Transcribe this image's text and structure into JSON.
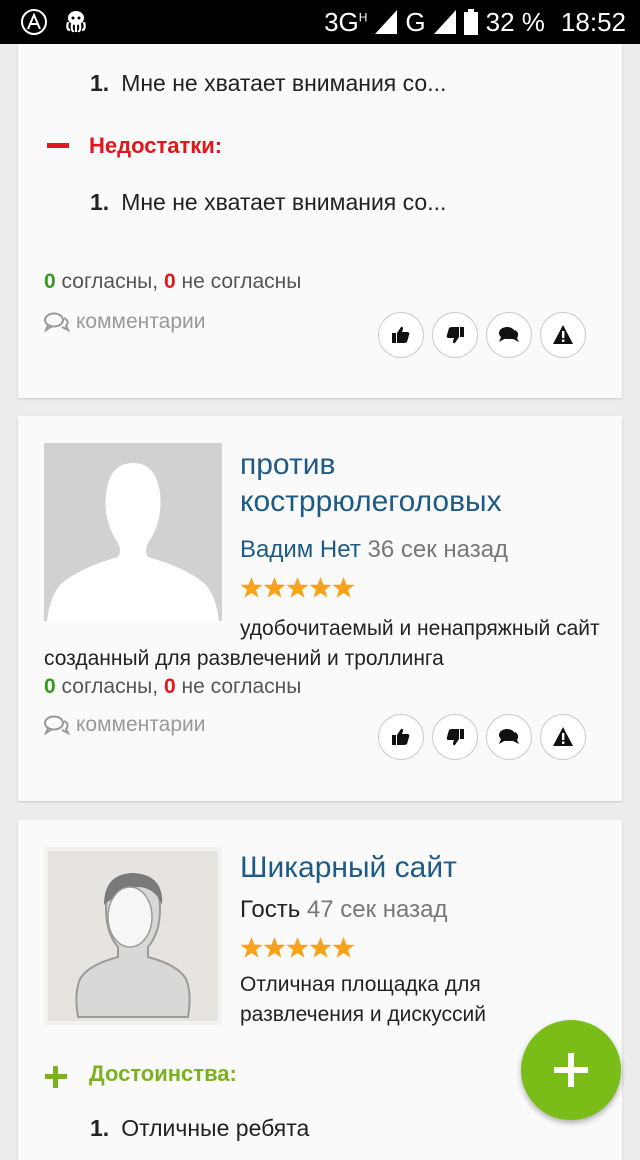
{
  "status_bar": {
    "network": "3G",
    "network_sup": "H",
    "network2": "G",
    "battery": "32 %",
    "time": "18:52"
  },
  "card1": {
    "pros_item": "Мне не хватает внимания со...",
    "cons_title": "Недостатки:",
    "cons_item": "Мне не хватает внимания со...",
    "agree_count": "0",
    "agree_label": "согласны,",
    "disagree_count": "0",
    "disagree_label": "не согласны",
    "comments_label": "комментарии"
  },
  "card2": {
    "title": "против костррюлеголовых",
    "author": "Вадим Нет",
    "time": "36 сек назад",
    "rating": 5,
    "text": "удобочитаемый и ненапряжный сайт созданный для развлечений и троллинга",
    "agree_count": "0",
    "agree_label": "согласны,",
    "disagree_count": "0",
    "disagree_label": "не согласны",
    "comments_label": "комментарии"
  },
  "card3": {
    "title": "Шикарный сайт",
    "author": "Гость",
    "time": "47 сек назад",
    "rating": 5,
    "text": "Отличная площадка для развлечения и дискуссий",
    "pros_title": "Достоинства:",
    "pros_item": "Отличные ребята"
  },
  "list_numbers": [
    "1.",
    "1.",
    "1."
  ],
  "colors": {
    "accent_green": "#7bbd18",
    "title_blue": "#1e5a86",
    "cons_red": "#e3171b",
    "star_orange": "#f7a21b"
  }
}
